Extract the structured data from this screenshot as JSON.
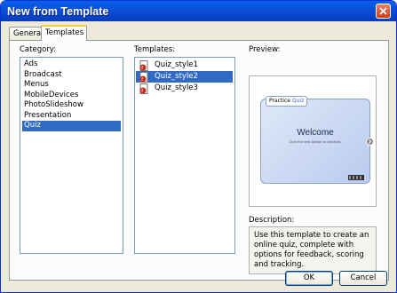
{
  "window": {
    "title": "New from Template"
  },
  "tabs": [
    {
      "label": "General"
    },
    {
      "label": "Templates"
    }
  ],
  "category": {
    "label": "Category:",
    "items": [
      "Ads",
      "Broadcast",
      "Menus",
      "MobileDevices",
      "PhotoSlideshow",
      "Presentation",
      "Quiz"
    ],
    "selected": "Quiz"
  },
  "templates": {
    "label": "Templates:",
    "items": [
      "Quiz_style1",
      "Quiz_style2",
      "Quiz_style3"
    ],
    "selected": "Quiz_style2"
  },
  "preview": {
    "label": "Preview:",
    "badge_prefix": "Practice",
    "badge_accent": "Quiz",
    "welcome": "Welcome",
    "sub": "Click the next button to continue."
  },
  "description": {
    "label": "Description:",
    "text": "Use this template to create an online quiz, complete with options for feedback, scoring and tracking."
  },
  "buttons": {
    "ok": "OK",
    "cancel": "Cancel"
  },
  "colors": {
    "titlebar": "#0a4fd8",
    "selection": "#316ac5",
    "tab_highlight": "#ffc83c"
  }
}
